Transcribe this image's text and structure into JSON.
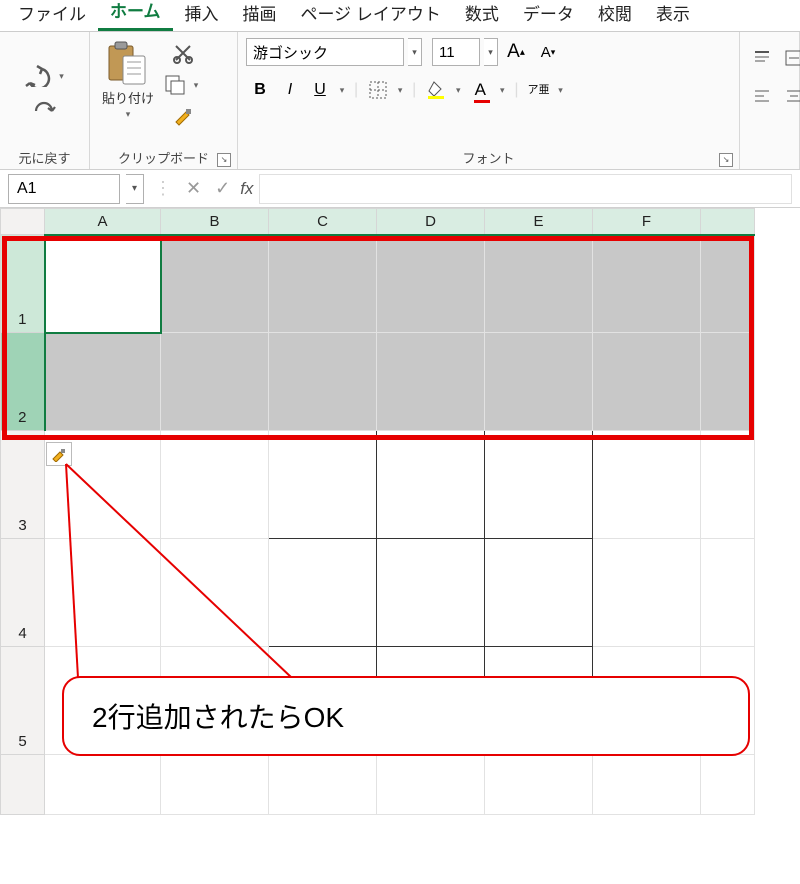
{
  "tabs": {
    "file": "ファイル",
    "home": "ホーム",
    "insert": "挿入",
    "draw": "描画",
    "pagelayout": "ページ レイアウト",
    "formulas": "数式",
    "data": "データ",
    "review": "校閲",
    "view": "表示"
  },
  "ribbon": {
    "undo_group": "元に戻す",
    "clipboard": {
      "paste": "貼り付け",
      "label": "クリップボード"
    },
    "font": {
      "name": "游ゴシック",
      "size": "11",
      "label": "フォント",
      "ruby": "ア亜"
    }
  },
  "formulaBar": {
    "nameBox": "A1",
    "fx": "fx"
  },
  "grid": {
    "cols": [
      "A",
      "B",
      "C",
      "D",
      "E",
      "F"
    ],
    "rows": [
      "1",
      "2",
      "3",
      "4",
      "5"
    ]
  },
  "callout": "2行追加されたらOK"
}
